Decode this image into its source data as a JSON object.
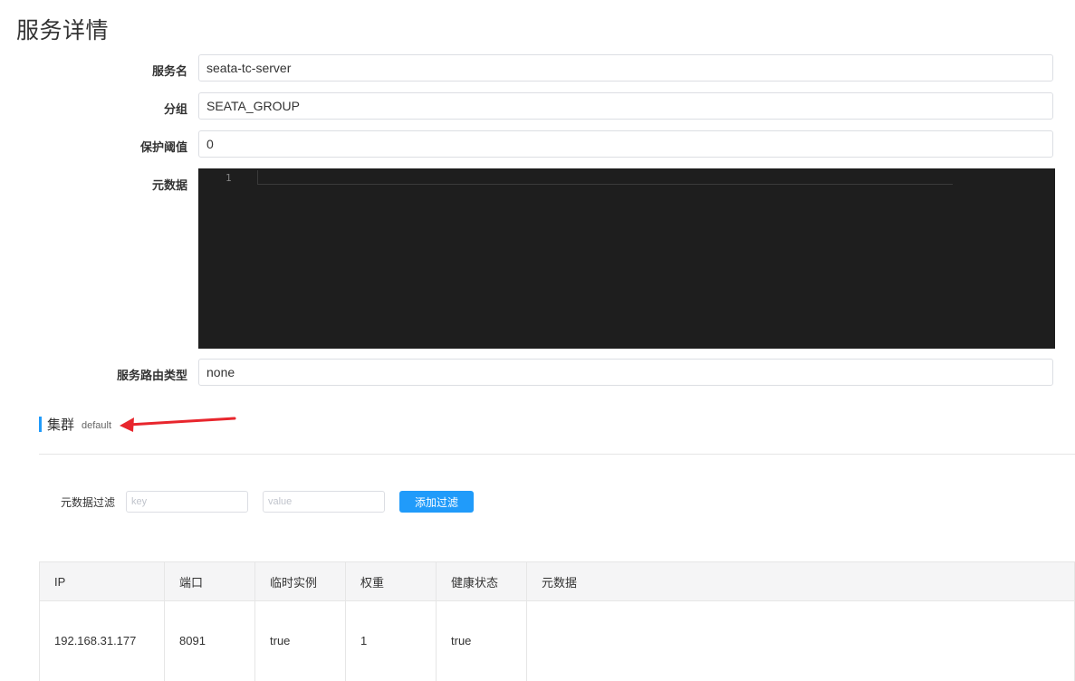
{
  "page": {
    "title": "服务详情"
  },
  "form": {
    "service_name": {
      "label": "服务名",
      "value": "seata-tc-server"
    },
    "group": {
      "label": "分组",
      "value": "SEATA_GROUP"
    },
    "protect_threshold": {
      "label": "保护阈值",
      "value": "0"
    },
    "metadata": {
      "label": "元数据",
      "line_number": "1"
    },
    "route_type": {
      "label": "服务路由类型",
      "value": "none"
    }
  },
  "cluster": {
    "title": "集群",
    "name": "default"
  },
  "filter": {
    "label": "元数据过滤",
    "key_placeholder": "key",
    "value_placeholder": "value",
    "add_label": "添加过滤"
  },
  "table": {
    "columns": [
      "IP",
      "端口",
      "临时实例",
      "权重",
      "健康状态",
      "元数据"
    ],
    "rows": [
      {
        "ip": "192.168.31.177",
        "port": "8091",
        "ephemeral": "true",
        "weight": "1",
        "healthy": "true",
        "metadata": ""
      }
    ]
  },
  "colors": {
    "accent": "#209bfa",
    "annotation_arrow": "#e8262d",
    "editor_bg": "#1e1e1e"
  }
}
